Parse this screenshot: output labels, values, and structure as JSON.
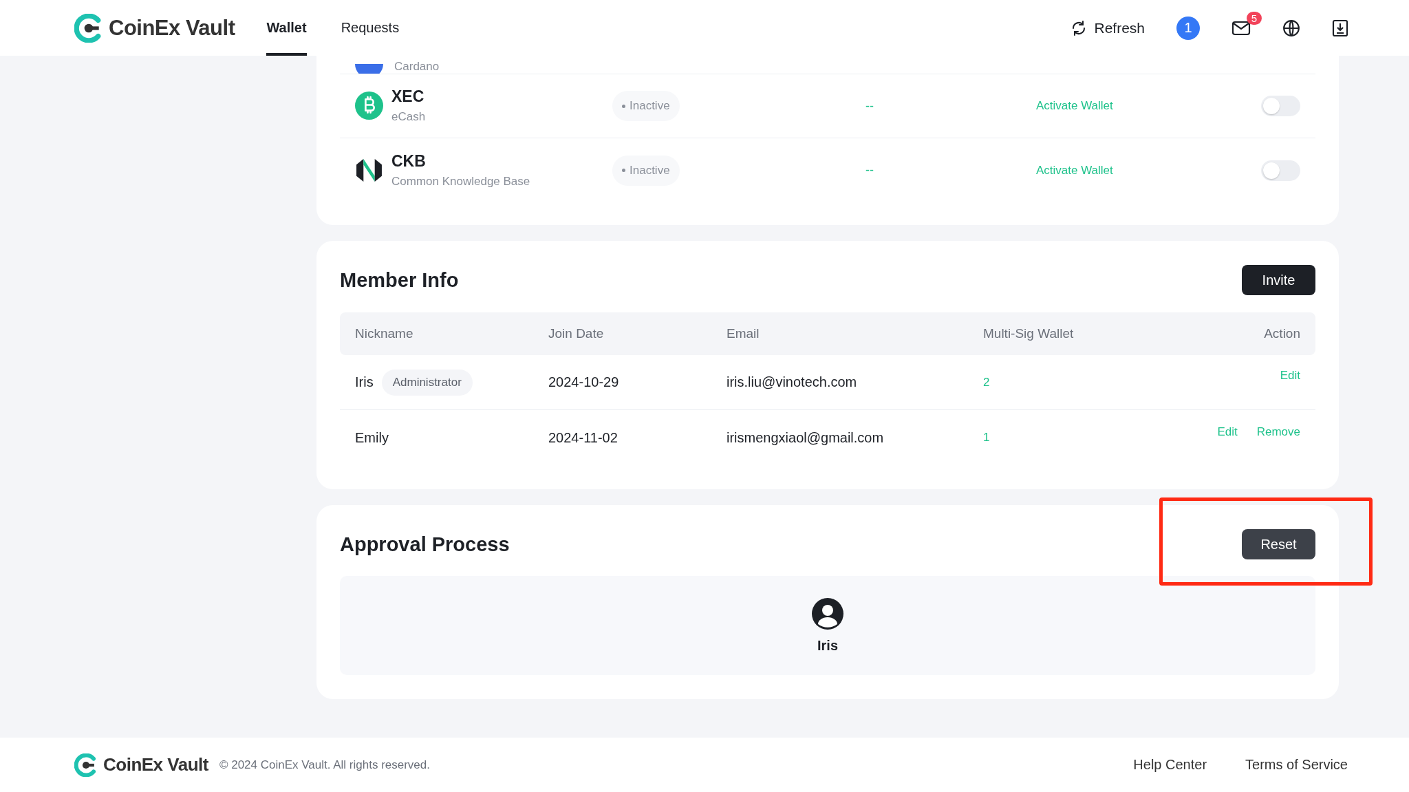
{
  "header": {
    "logo": "CoinEx Vault",
    "nav": [
      {
        "label": "Wallet",
        "selected": true
      },
      {
        "label": "Requests",
        "selected": false
      }
    ],
    "refresh": "Refresh",
    "account_badge": "1",
    "mail_count": "5"
  },
  "wallets": {
    "partial_row": {
      "subtitle": "Cardano"
    },
    "rows": [
      {
        "kind": "xec",
        "symbol": "XEC",
        "name": "eCash",
        "status": "Inactive",
        "balance": "--",
        "action": "Activate Wallet",
        "on": false
      },
      {
        "kind": "ckb",
        "symbol": "CKB",
        "name": "Common Knowledge Base",
        "status": "Inactive",
        "balance": "--",
        "action": "Activate Wallet",
        "on": false
      }
    ]
  },
  "members": {
    "title": "Member Info",
    "invite": "Invite",
    "columns": [
      "Nickname",
      "Join Date",
      "Email",
      "Multi-Sig Wallet",
      "Action"
    ],
    "rows": [
      {
        "nickname": "Iris",
        "role": "Administrator",
        "join_date": "2024-10-29",
        "email": "iris.liu@vinotech.com",
        "wallets": "2",
        "actions": [
          "Edit"
        ]
      },
      {
        "nickname": "Emily",
        "join_date": "2024-11-02",
        "email": "irismengxiaol@gmail.com",
        "wallets": "1",
        "actions": [
          "Edit",
          "Remove"
        ]
      }
    ]
  },
  "approval": {
    "title": "Approval Process",
    "reset": "Reset",
    "highlighted": true,
    "approvers": [
      {
        "name": "Iris"
      }
    ]
  },
  "footer": {
    "logo": "CoinEx Vault",
    "copyright": "© 2024 CoinEx Vault. All rights reserved.",
    "links": [
      "Help Center",
      "Terms of Service"
    ]
  }
}
